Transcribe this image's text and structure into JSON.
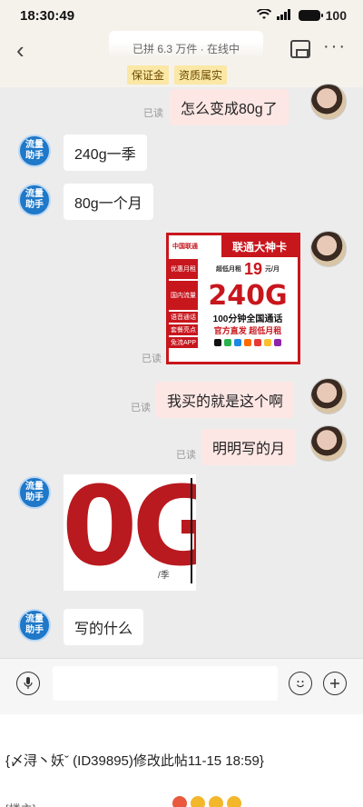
{
  "status": {
    "time": "18:30:49",
    "battery": "100"
  },
  "header": {
    "title_fragment": "已拼 6.3 万件 · 在线中",
    "badges": [
      "保证金",
      "资质属实"
    ]
  },
  "messages": {
    "m1": "怎么变成80g了",
    "m2": "240g一季",
    "m3": "80g一个月",
    "m5": "我买的就是这个啊",
    "m6": "明明写的月",
    "m8": "写的什么",
    "read": "已读",
    "bot_name": "流量助手"
  },
  "card": {
    "logo": "中国联通",
    "banner": "联通大神卡",
    "row1_label": "优惠月租",
    "row1_tiny": "超低月租",
    "row1_price": "19",
    "row1_unit": "元/月",
    "row2_label": "国内流量",
    "row2_value": "240G",
    "row3_label": "语音通话",
    "row3_value": "100分钟全国通话",
    "row4_label": "套餐亮点",
    "row4_value": "官方直发  超低月租",
    "row5_label": "免流APP"
  },
  "image_msg": {
    "big_text": "0G",
    "unit": "/季"
  },
  "footer": {
    "edit_note": "{〆浔丶妖ˇ (ID39895)修改此帖11-15 18:59}",
    "cut_text": "[楼主]"
  },
  "colors": {
    "accent_red": "#c8161d",
    "bot_blue": "#1f78c8",
    "bubble_pink": "#fde7e5"
  }
}
